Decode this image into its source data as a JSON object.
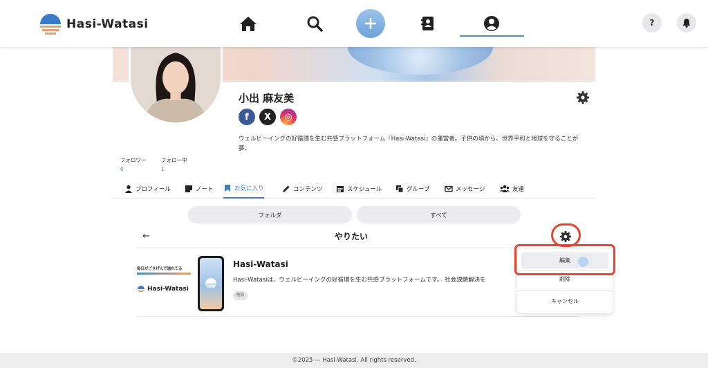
{
  "header": {
    "logo_text": "Hasi-Watasi",
    "help_label": "?"
  },
  "profile": {
    "name": "小出 麻友美",
    "bio": "ウェルビーイングの好循環を生む共感プラットフォーム『Hasi-Watasi』の運営者。子供の頃から、世界平和と地球を守ることが夢。",
    "social": [
      {
        "name": "facebook",
        "glyph": "f",
        "color": "#3b5998"
      },
      {
        "name": "x",
        "glyph": "X",
        "color": "#222222"
      },
      {
        "name": "instagram",
        "glyph": "◎",
        "color": "#d6336c"
      }
    ],
    "followers_label": "フォロワー",
    "followers_value": "0",
    "following_label": "フォロー中",
    "following_value": "1"
  },
  "tabs": [
    {
      "label": "プロフィール",
      "icon": "person-icon"
    },
    {
      "label": "ノート",
      "icon": "note-icon"
    },
    {
      "label": "お気に入り",
      "icon": "bookmark-icon",
      "active": true
    },
    {
      "label": "コンテンツ",
      "icon": "pencil-icon"
    },
    {
      "label": "スケジュール",
      "icon": "calendar-icon"
    },
    {
      "label": "グループ",
      "icon": "group-icon"
    },
    {
      "label": "メッセージ",
      "icon": "mail-icon"
    },
    {
      "label": "友達",
      "icon": "friends-icon"
    }
  ],
  "filters": {
    "folder_label": "フォルダ",
    "all_label": "すべて"
  },
  "folder": {
    "title": "やりたい",
    "back_glyph": "←"
  },
  "item": {
    "thumb_caption": "毎日がごきげんで溢れてる",
    "thumb_logo": "Hasi-Watasi",
    "title": "Hasi-Watasi",
    "description": "Hasi-Watasiは、ウェルビーイングの好循環を生む共感プラットフォームです。 社会課題解決を",
    "tag": "削除"
  },
  "menu": {
    "edit_label": "編集",
    "delete_label": "削除",
    "cancel_label": "キャンセル"
  },
  "footer": {
    "text": "©2025 — Hasi-Watasi. All rights reserved."
  },
  "colors": {
    "accent": "#3f7fc0",
    "highlight": "#e8432e"
  }
}
